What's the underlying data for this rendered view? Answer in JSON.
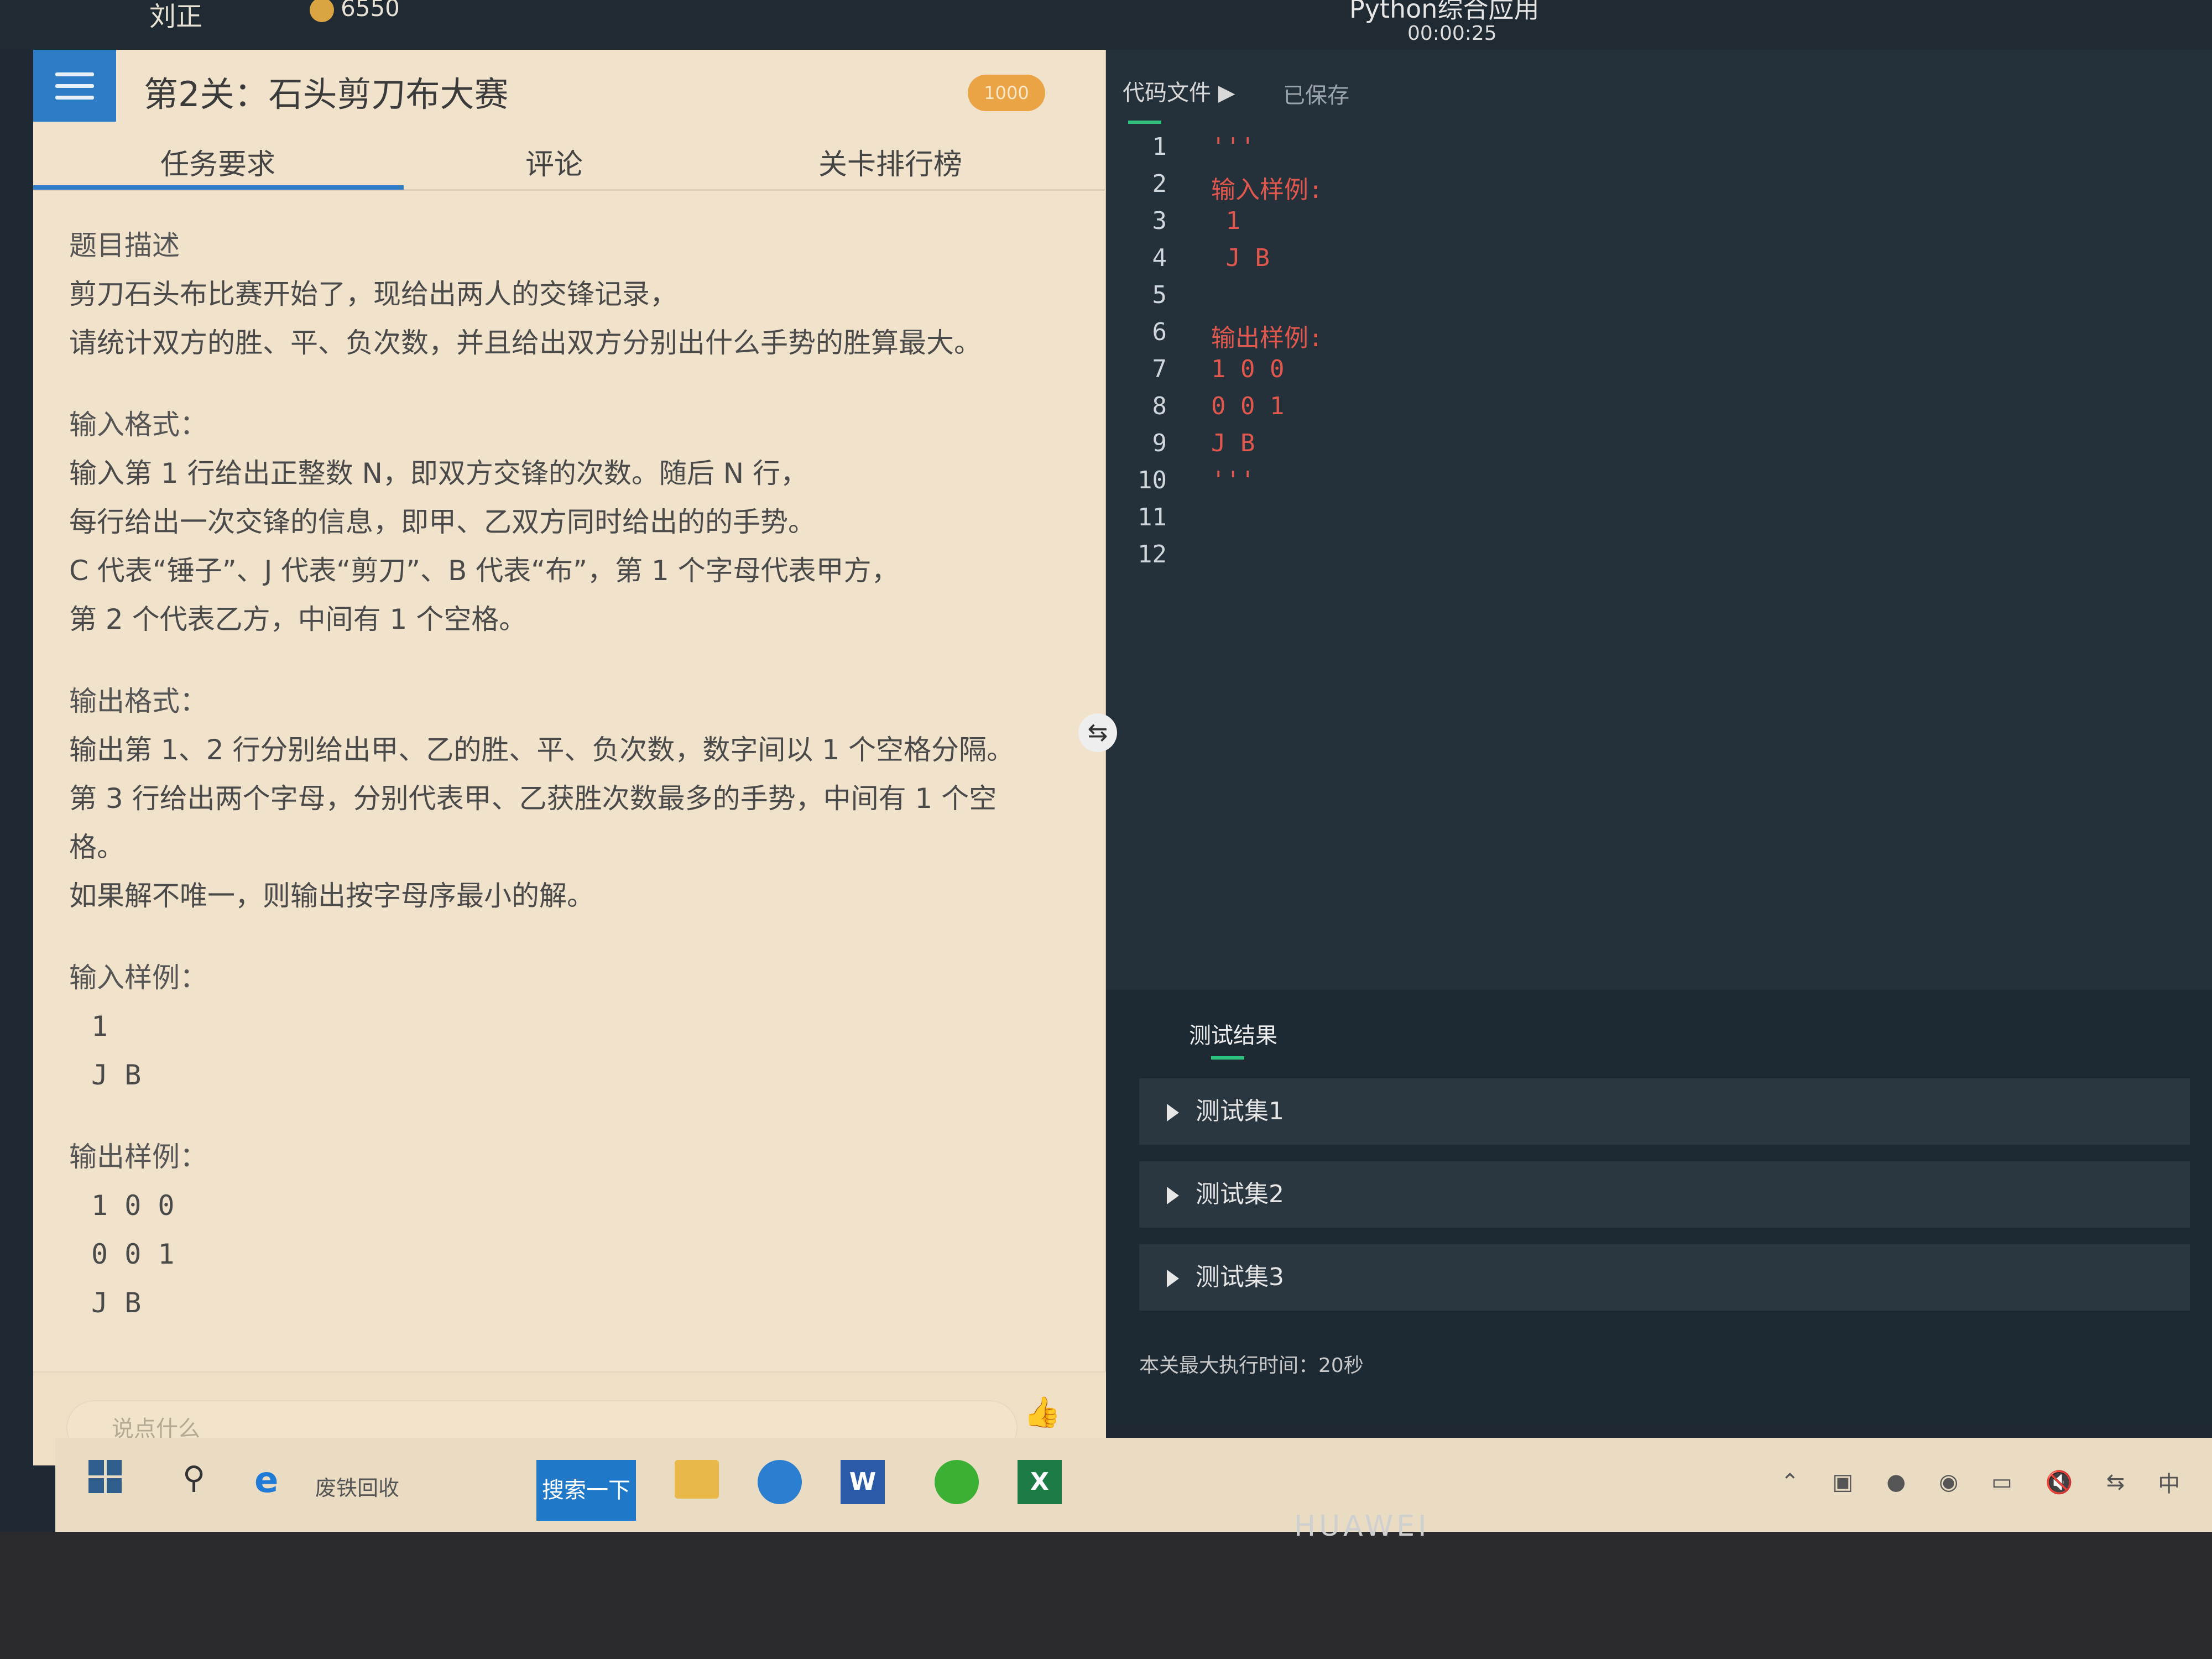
{
  "top_bar": {
    "user_name": "刘正",
    "coins": "6550",
    "window_title": "Python综合应用",
    "timer": "00:00:25"
  },
  "task_panel": {
    "level_title": "第2关：石头剪刀布大赛",
    "score_badge": "1000",
    "tabs": [
      "任务要求",
      "评论",
      "关卡排行榜"
    ],
    "active_tab": "任务要求",
    "content": {
      "desc_title": "题目描述",
      "desc_lines": [
        "剪刀石头布比赛开始了，现给出两人的交锋记录，",
        "请统计双方的胜、平、负次数，并且给出双方分别出什么手势的胜算最大。"
      ],
      "input_format_title": "输入格式：",
      "input_format_lines": [
        "输入第 1 行给出正整数 N，即双方交锋的次数。随后 N 行，",
        "每行给出一次交锋的信息，即甲、乙双方同时给出的的手势。",
        "C 代表“锤子”、J 代表“剪刀”、B 代表“布”，第 1 个字母代表甲方，",
        "第 2 个代表乙方，中间有 1 个空格。"
      ],
      "output_format_title": "输出格式：",
      "output_format_lines": [
        "输出第 1、2 行分别给出甲、乙的胜、平、负次数，数字间以 1 个空格分隔。",
        "第 3 行给出两个字母，分别代表甲、乙获胜次数最多的手势，中间有 1 个空",
        "格。",
        "如果解不唯一，则输出按字母序最小的解。"
      ],
      "input_sample_title": "输入样例：",
      "input_sample_lines": [
        "1",
        "J B"
      ],
      "output_sample_title": "输出样例：",
      "output_sample_lines": [
        "1 0 0",
        "0 0 1",
        "J B"
      ]
    },
    "comment_placeholder": "说点什么"
  },
  "editor": {
    "file_tab": "代码文件",
    "save_status": "已保存",
    "lines": [
      {
        "num": "1",
        "text": "'''"
      },
      {
        "num": "2",
        "text": "输入样例:"
      },
      {
        "num": "3",
        "text": " 1"
      },
      {
        "num": "4",
        "text": " J B"
      },
      {
        "num": "5",
        "text": ""
      },
      {
        "num": "6",
        "text": "输出样例:"
      },
      {
        "num": "7",
        "text": "1 0 0"
      },
      {
        "num": "8",
        "text": "0 0 1"
      },
      {
        "num": "9",
        "text": "J B"
      },
      {
        "num": "10",
        "text": "'''"
      },
      {
        "num": "11",
        "text": ""
      },
      {
        "num": "12",
        "text": ""
      }
    ]
  },
  "results": {
    "tab_label": "测试结果",
    "test_sets": [
      "测试集1",
      "测试集2",
      "测试集3"
    ],
    "max_time": "本关最大执行时间：20秒"
  },
  "taskbar": {
    "browser_text": "废铁回收",
    "search_button": "搜索一下",
    "tray_ime": "中"
  },
  "device_brand": "HUAWEI",
  "colors": {
    "accent_blue": "#2e7cc6",
    "badge_orange": "#eaa445",
    "code_red": "#e0574d",
    "tab_green": "#2ec27e"
  }
}
